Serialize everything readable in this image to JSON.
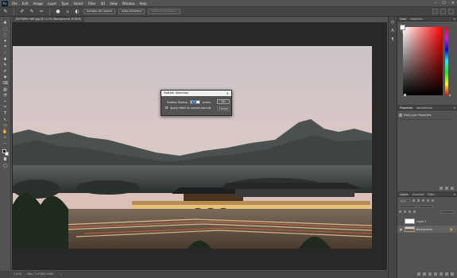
{
  "app": {
    "logo": "Ps"
  },
  "menu": [
    "File",
    "Edit",
    "Image",
    "Layer",
    "Type",
    "Select",
    "Filter",
    "3D",
    "View",
    "Window",
    "Help"
  ],
  "window_controls": {
    "minimize": "–",
    "maximize": "☐",
    "close": "✕"
  },
  "options": {
    "brush_size": "20",
    "sample_all_layers": "Sample All Layers",
    "auto_enhance": "Auto-Enhance",
    "select_and_mask": "Select and Mask..."
  },
  "document_tab": {
    "title": "_DSF9690-HDR.jpg @ 111% (Background, RGB/8)",
    "close": "×"
  },
  "status": {
    "zoom": "111%",
    "doc_size": "Doc: 1.42M/1.90M",
    "arrow": "›"
  },
  "dialog": {
    "title": "Feather Selection",
    "close": "×",
    "feather_label": "Feather Radius:",
    "feather_value": "13",
    "unit": "pixels",
    "apply_label": "Apply effect at canvas bounds",
    "ok": "OK",
    "cancel": "Cancel"
  },
  "tools": [
    "✥",
    "⬚",
    "◌",
    "✦",
    "⌗",
    "⟋",
    "✚",
    "✎",
    "✐",
    "◈",
    "⌫",
    "▥",
    "◔",
    "⌁",
    "✑",
    "T",
    "↖",
    "▭",
    "✋",
    "⌕",
    "⋯"
  ],
  "panels": {
    "color_tabs": [
      "Color",
      "Swatches"
    ],
    "properties_tabs": [
      "Properties",
      "Adjustments"
    ],
    "properties_sub": "Pixel Layer Properties",
    "layers_tabs": [
      "Layers",
      "Channels",
      "Paths"
    ],
    "layers_kind": "Kind",
    "layers": [
      {
        "name": "Layer 1",
        "visible": false,
        "thumb": "white"
      },
      {
        "name": "Background",
        "visible": true,
        "thumb": "photo",
        "locked": true
      }
    ]
  }
}
